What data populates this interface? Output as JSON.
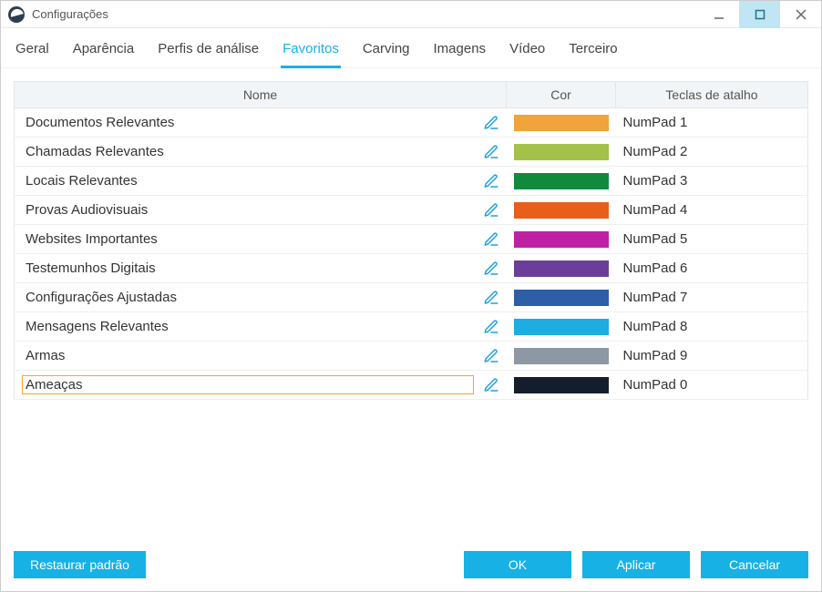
{
  "window": {
    "title": "Configurações"
  },
  "tabs": [
    {
      "id": "geral",
      "label": "Geral",
      "active": false
    },
    {
      "id": "aparencia",
      "label": "Aparência",
      "active": false
    },
    {
      "id": "perfis",
      "label": "Perfis de análise",
      "active": false
    },
    {
      "id": "favoritos",
      "label": "Favoritos",
      "active": true
    },
    {
      "id": "carving",
      "label": "Carving",
      "active": false
    },
    {
      "id": "imagens",
      "label": "Imagens",
      "active": false
    },
    {
      "id": "video",
      "label": "Vídeo",
      "active": false
    },
    {
      "id": "terceiro",
      "label": "Terceiro",
      "active": false
    }
  ],
  "table": {
    "columns": {
      "name": "Nome",
      "color": "Cor",
      "keys": "Teclas de atalho"
    },
    "rows": [
      {
        "name": "Documentos Relevantes",
        "color": "#f0a43a",
        "keys": "NumPad 1",
        "editing": false
      },
      {
        "name": "Chamadas Relevantes",
        "color": "#a4c14a",
        "keys": "NumPad 2",
        "editing": false
      },
      {
        "name": "Locais Relevantes",
        "color": "#128a3d",
        "keys": "NumPad 3",
        "editing": false
      },
      {
        "name": "Provas Audiovisuais",
        "color": "#e85e1b",
        "keys": "NumPad 4",
        "editing": false
      },
      {
        "name": "Websites Importantes",
        "color": "#c021a4",
        "keys": "NumPad 5",
        "editing": false
      },
      {
        "name": "Testemunhos Digitais",
        "color": "#6b3f99",
        "keys": "NumPad 6",
        "editing": false
      },
      {
        "name": "Configurações Ajustadas",
        "color": "#2d5ea6",
        "keys": "NumPad 7",
        "editing": false
      },
      {
        "name": "Mensagens Relevantes",
        "color": "#1dade0",
        "keys": "NumPad 8",
        "editing": false
      },
      {
        "name": "Armas",
        "color": "#8d98a2",
        "keys": "NumPad 9",
        "editing": false
      },
      {
        "name": "Ameaças",
        "color": "#131d2b",
        "keys": "NumPad 0",
        "editing": true
      }
    ]
  },
  "buttons": {
    "restore": "Restaurar padrão",
    "ok": "OK",
    "apply": "Aplicar",
    "cancel": "Cancelar"
  }
}
